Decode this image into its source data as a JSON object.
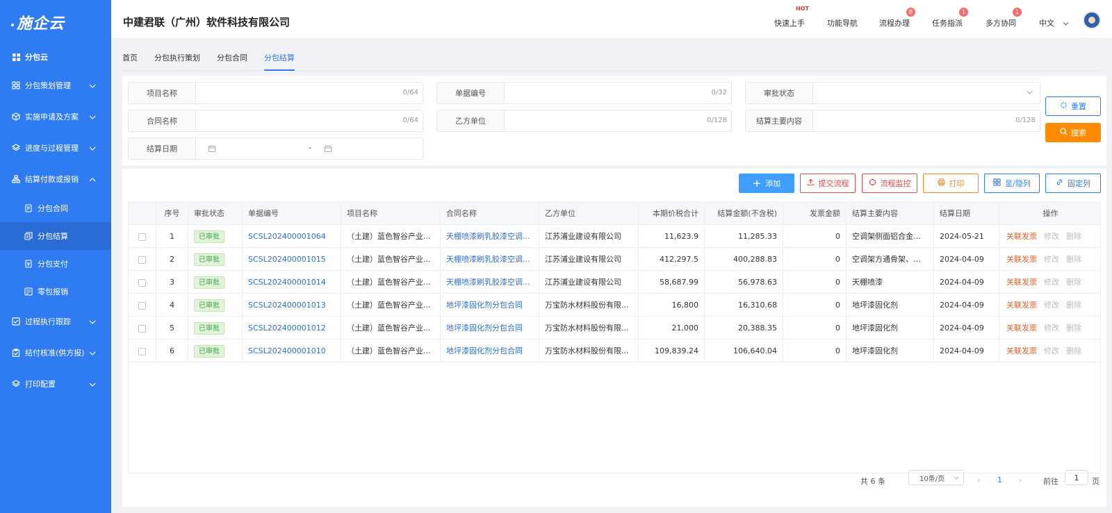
{
  "sidebar": {
    "logo": "施企云",
    "items": [
      {
        "label": "分包云",
        "icon": "grid-icon"
      },
      {
        "label": "分包策划管理",
        "icon": "apps-icon"
      },
      {
        "label": "实施申请及方案",
        "icon": "cube-icon"
      },
      {
        "label": "进度与过程管理",
        "icon": "layers-icon"
      },
      {
        "label": "结算付款或报销",
        "icon": "org-icon"
      },
      {
        "label": "过程执行跟踪",
        "icon": "tracking-icon"
      },
      {
        "label": "结付核准(供方报)",
        "icon": "clipboard-icon"
      },
      {
        "label": "打印配置",
        "icon": "layers-icon"
      }
    ],
    "subitems": [
      {
        "label": "分包合同",
        "icon": "contract-icon"
      },
      {
        "label": "分包结算",
        "icon": "settlement-icon"
      },
      {
        "label": "分包支付",
        "icon": "payment-icon"
      },
      {
        "label": "零包报销",
        "icon": "reimburse-icon"
      }
    ]
  },
  "header": {
    "company": "中建君联（广州）软件科技有限公司",
    "nav": [
      {
        "label": "快速上手",
        "badge": "",
        "hot": "HOT"
      },
      {
        "label": "功能导航",
        "badge": ""
      },
      {
        "label": "流程办理",
        "badge": "8"
      },
      {
        "label": "任务指派",
        "badge": "1"
      },
      {
        "label": "多方协同",
        "badge": "1"
      }
    ],
    "language": "中文"
  },
  "tabs": [
    "首页",
    "分包执行策划",
    "分包合同",
    "分包结算"
  ],
  "filters": {
    "project_name": {
      "label": "项目名称",
      "count": "0/64"
    },
    "doc_no": {
      "label": "单据编号",
      "count": "0/32"
    },
    "approval_status": {
      "label": "审批状态"
    },
    "contract_name": {
      "label": "合同名称",
      "count": "0/64"
    },
    "party_b": {
      "label": "乙方单位",
      "count": "0/128"
    },
    "main_content": {
      "label": "结算主要内容",
      "count": "0/128"
    },
    "settle_date": {
      "label": "结算日期",
      "separator": "-"
    },
    "reset": "重置",
    "search": "搜索"
  },
  "toolbar": {
    "add": "添加",
    "submit_flow": "提交流程",
    "flow_monitor": "流程监控",
    "print": "打印",
    "toggle_columns": "显/隐列",
    "fixed_columns": "固定列"
  },
  "table": {
    "headers": [
      "序号",
      "审批状态",
      "单据编号",
      "项目名称",
      "合同名称",
      "乙方单位",
      "本期价税合计",
      "结算金额(不含税)",
      "发票金额",
      "结算主要内容",
      "结算日期",
      "操作"
    ],
    "rows": [
      {
        "no": "1",
        "status": "已审批",
        "doc": "SCSL202400001064",
        "project": "（土建）蓝色智谷产业...",
        "contract": "天棚喷漆刷乳胶漆空调...",
        "party": "江苏浦业建设有限公司",
        "total": "11,623.9",
        "amount": "11,285.33",
        "invoice": "0",
        "content": "空调架侧面铝合金百叶",
        "date": "2024-05-21"
      },
      {
        "no": "2",
        "status": "已审批",
        "doc": "SCSL202400001015",
        "project": "（土建）蓝色智谷产业...",
        "contract": "天棚喷漆刷乳胶漆空调...",
        "party": "江苏浦业建设有限公司",
        "total": "412,297.5",
        "amount": "400,288.83",
        "invoice": "0",
        "content": "空调架方通骨架、空...",
        "date": "2024-04-09"
      },
      {
        "no": "3",
        "status": "已审批",
        "doc": "SCSL202400001014",
        "project": "（土建）蓝色智谷产业...",
        "contract": "天棚喷漆刷乳胶漆空调...",
        "party": "江苏浦业建设有限公司",
        "total": "58,687.99",
        "amount": "56,978.63",
        "invoice": "0",
        "content": "天棚喷漆",
        "date": "2024-04-09"
      },
      {
        "no": "4",
        "status": "已审批",
        "doc": "SCSL202400001013",
        "project": "（土建）蓝色智谷产业...",
        "contract": "地坪漆固化剂分包合同",
        "party": "万宝防水材料股份有限...",
        "total": "16,800",
        "amount": "16,310.68",
        "invoice": "0",
        "content": "地坪漆固化剂",
        "date": "2024-04-09"
      },
      {
        "no": "5",
        "status": "已审批",
        "doc": "SCSL202400001012",
        "project": "（土建）蓝色智谷产业...",
        "contract": "地坪漆固化剂分包合同",
        "party": "万宝防水材料股份有限...",
        "total": "21,000",
        "amount": "20,388.35",
        "invoice": "0",
        "content": "地坪漆固化剂",
        "date": "2024-04-09"
      },
      {
        "no": "6",
        "status": "已审批",
        "doc": "SCSL202400001010",
        "project": "（土建）蓝色智谷产业...",
        "contract": "地坪漆固化剂分包合同",
        "party": "万宝防水材料股份有限...",
        "total": "109,839.24",
        "amount": "106,640.04",
        "invoice": "0",
        "content": "地坪漆固化剂",
        "date": "2024-04-09"
      }
    ],
    "ops": {
      "link": "关联发票",
      "edit": "修改",
      "delete": "删除"
    }
  },
  "pagination": {
    "total": "共 6 条",
    "page_size": "10条/页",
    "current": "1",
    "goto_prefix": "前往",
    "goto_value": "1",
    "goto_suffix": "页"
  }
}
